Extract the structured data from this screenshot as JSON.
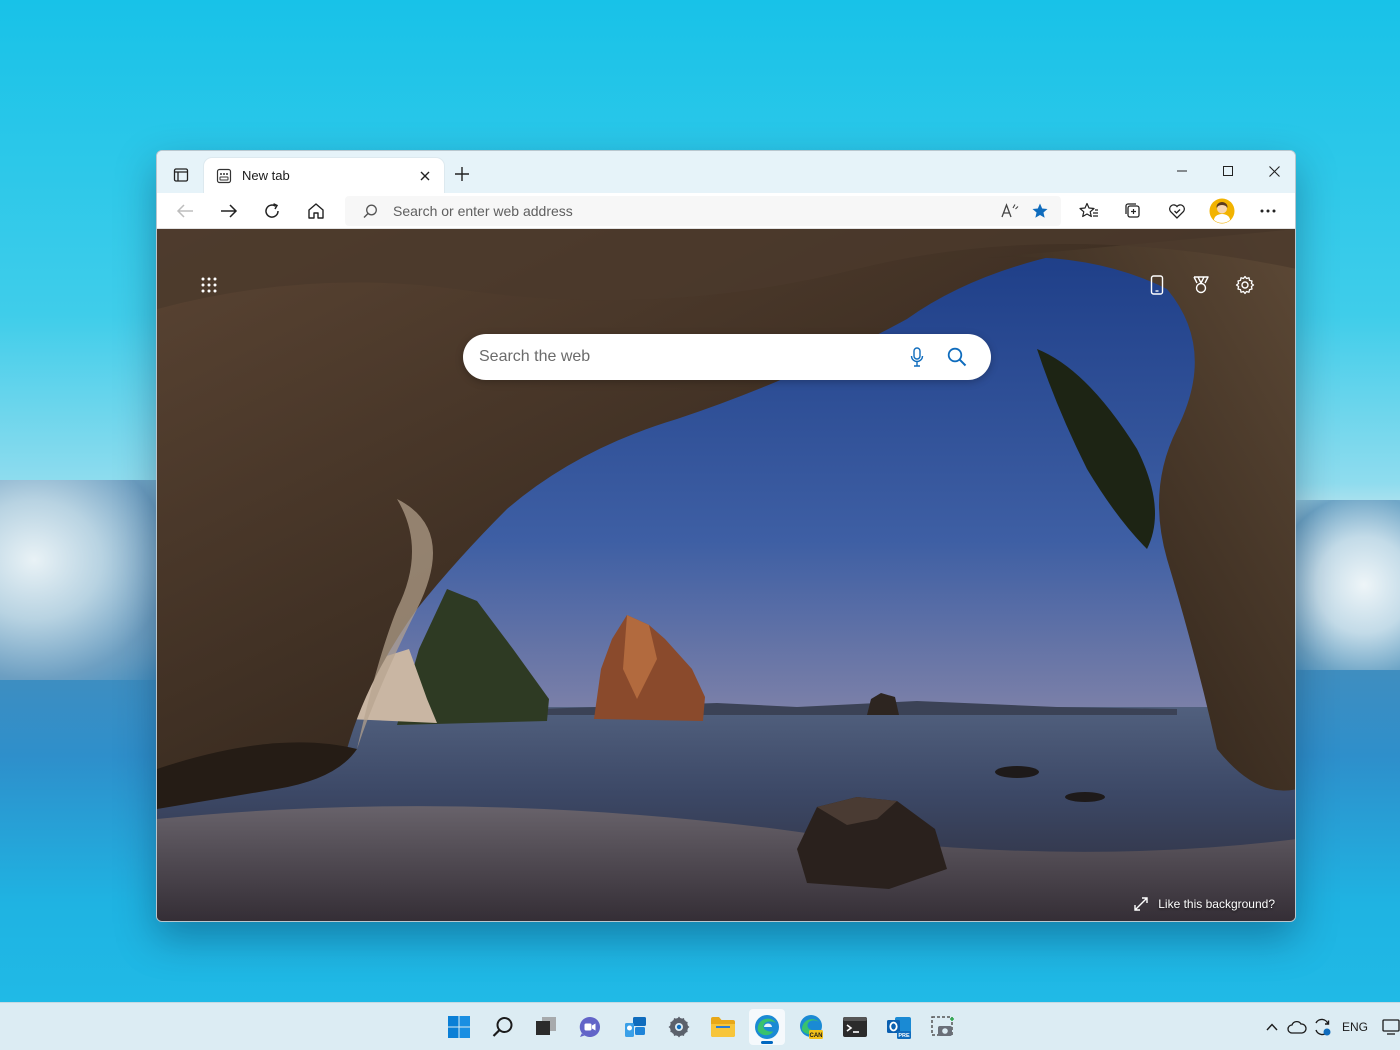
{
  "window": {
    "tab": {
      "title": "New tab"
    },
    "address_bar": {
      "placeholder": "Search or enter web address"
    }
  },
  "newtab": {
    "search": {
      "placeholder": "Search the web"
    },
    "like_background": "Like this background?"
  },
  "taskbar": {
    "items": [
      "start-icon",
      "search-icon",
      "task-view-icon",
      "teams-chat-icon",
      "widgets-icon",
      "settings-icon",
      "file-explorer-icon",
      "edge-icon",
      "edge-canary-icon",
      "terminal-icon",
      "outlook-preview-icon",
      "snipping-tool-icon"
    ],
    "tray_language": "ENG"
  },
  "colors": {
    "accent": "#0067c0",
    "titlebar": "#e6f3f9",
    "favorite_star": "#0f6cbd"
  }
}
